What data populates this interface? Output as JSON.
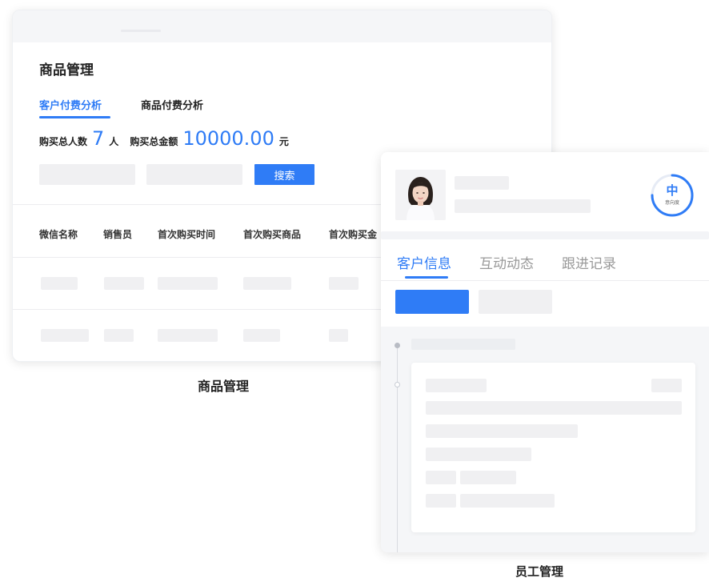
{
  "product_panel": {
    "title": "商品管理",
    "tabs": [
      {
        "label": "客户付费分析",
        "active": true
      },
      {
        "label": "商品付费分析",
        "active": false
      }
    ],
    "summary": {
      "buyers_label": "购买总人数",
      "buyers_count": "7",
      "buyers_unit": "人",
      "amount_label": "购买总金额",
      "amount_value": "10000.00",
      "amount_unit": "元"
    },
    "search_button": "搜索",
    "table_headers": [
      "微信名称",
      "销售员",
      "首次购买时间",
      "首次购买商品",
      "首次购买金"
    ]
  },
  "product_caption": "商品管理",
  "employee_panel": {
    "intent_level": "中",
    "intent_label": "意向度",
    "intent_progress": 0.75,
    "tabs": [
      {
        "label": "客户信息",
        "active": true
      },
      {
        "label": "互动动态",
        "active": false
      },
      {
        "label": "跟进记录",
        "active": false
      }
    ]
  },
  "employee_caption": "员工管理",
  "colors": {
    "accent": "#2f7cf6",
    "skeleton": "#f0f0f2"
  }
}
